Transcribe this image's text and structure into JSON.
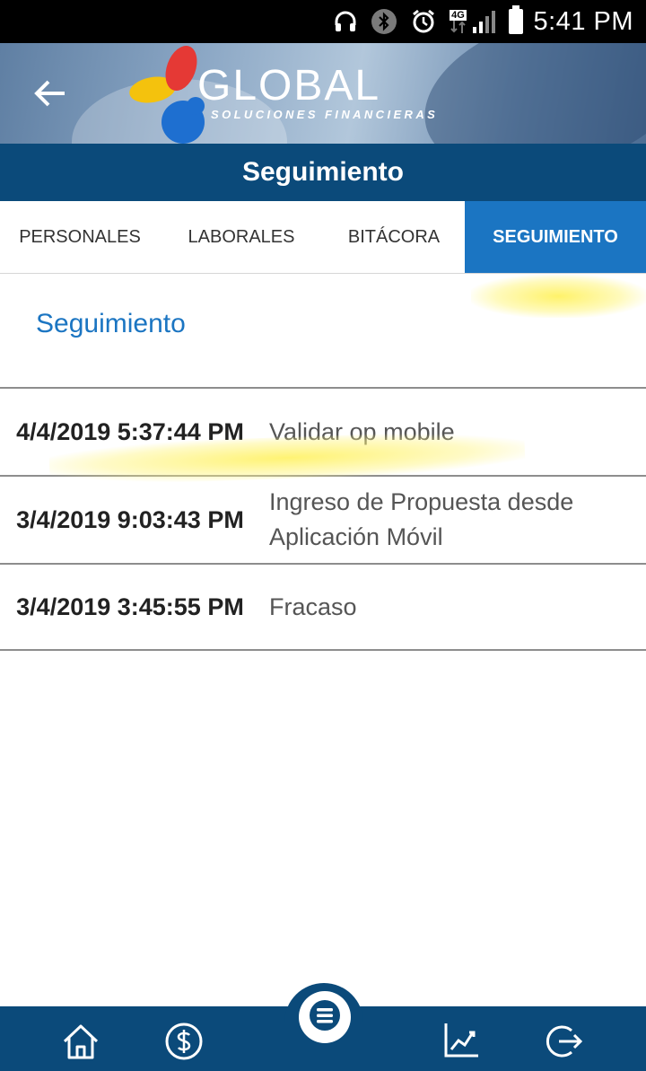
{
  "status_bar": {
    "time": "5:41 PM",
    "network_label": "4G",
    "icons": [
      "headphones-icon",
      "bluetooth-icon",
      "alarm-icon",
      "signal-icon",
      "battery-icon"
    ]
  },
  "header": {
    "logo_text": "GLOBAL",
    "logo_subtitle": "SOLUCIONES FINANCIERAS",
    "title": "Seguimiento"
  },
  "tabs": [
    {
      "label": "PERSONALES",
      "active": false
    },
    {
      "label": "LABORALES",
      "active": false
    },
    {
      "label": "BITÁCORA",
      "active": false
    },
    {
      "label": "SEGUIMIENTO",
      "active": true
    }
  ],
  "main": {
    "section_title": "Seguimiento",
    "rows": [
      {
        "date": "4/4/2019 5:37:44 PM",
        "description": "Validar op mobile"
      },
      {
        "date": "3/4/2019 9:03:43 PM",
        "description": "Ingreso de Propuesta desde Aplicación Móvil"
      },
      {
        "date": "3/4/2019 3:45:55 PM",
        "description": "Fracaso"
      }
    ]
  },
  "bottom_nav": {
    "items": [
      "home-icon",
      "dollar-icon",
      "menu-icon",
      "chart-icon",
      "logout-icon"
    ]
  },
  "colors": {
    "primary_dark": "#0b4a7a",
    "accent_blue": "#1b75c2",
    "highlight": "#fff066"
  }
}
